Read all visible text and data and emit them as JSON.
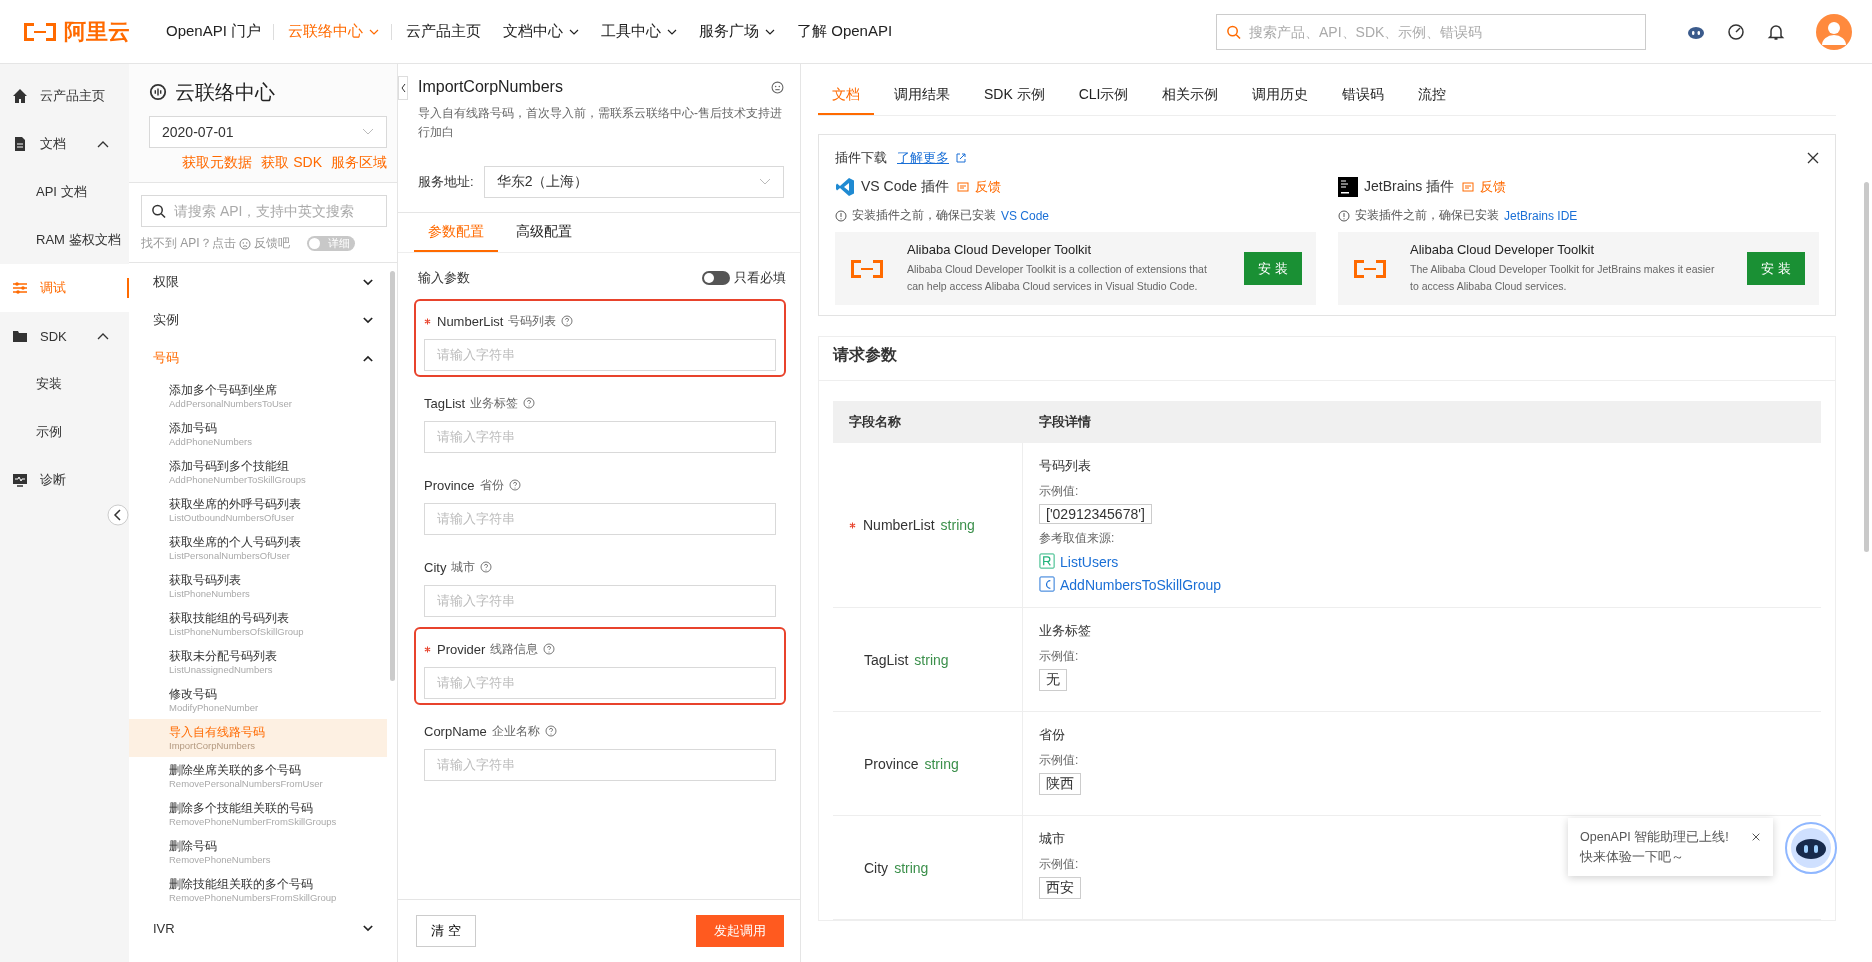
{
  "header": {
    "logo_text": "阿里云",
    "nav": [
      {
        "label": "OpenAPI 门户",
        "selected": false,
        "caret": false
      },
      {
        "label": "云联络中心",
        "selected": true,
        "caret": true
      },
      {
        "label": "云产品主页",
        "selected": false,
        "caret": false
      },
      {
        "label": "文档中心",
        "selected": false,
        "caret": true
      },
      {
        "label": "工具中心",
        "selected": false,
        "caret": true
      },
      {
        "label": "服务广场",
        "selected": false,
        "caret": true
      },
      {
        "label": "了解 OpenAPI",
        "selected": false,
        "caret": false
      }
    ],
    "search": {
      "placeholder": "搜索产品、API、SDK、示例、错误码"
    }
  },
  "sidebar": {
    "items": [
      {
        "kind": "home",
        "label": "云产品主页",
        "selected": false
      },
      {
        "kind": "doc",
        "label": "文档",
        "selected": false,
        "expanded": true,
        "children": [
          {
            "label": "API 文档",
            "selected": false
          },
          {
            "label": "RAM 鉴权文档",
            "selected": false
          }
        ]
      },
      {
        "kind": "debug",
        "label": "调试",
        "selected": true
      },
      {
        "kind": "sdk",
        "label": "SDK",
        "selected": false,
        "expanded": true,
        "children": [
          {
            "label": "安装",
            "selected": false
          },
          {
            "label": "示例",
            "selected": false
          }
        ]
      },
      {
        "kind": "diag",
        "label": "诊断",
        "selected": false
      }
    ]
  },
  "api_panel": {
    "title": "云联络中心",
    "version": "2020-07-01",
    "links": [
      "获取元数据",
      "获取 SDK",
      "服务区域"
    ],
    "search": {
      "placeholder": "请搜索 API，支持中英文搜索"
    },
    "feedback_prefix": "找不到 API？点击",
    "feedback_link": "反馈吧",
    "detail_toggle": {
      "label": "详细",
      "on": false
    },
    "groups": [
      {
        "label": "权限",
        "expanded": false,
        "selected": false
      },
      {
        "label": "实例",
        "expanded": false,
        "selected": false
      },
      {
        "label": "号码",
        "expanded": true,
        "selected": true,
        "items": [
          {
            "name": "添加多个号码到坐席",
            "code": "AddPersonalNumbersToUser",
            "selected": false
          },
          {
            "name": "添加号码",
            "code": "AddPhoneNumbers",
            "selected": false
          },
          {
            "name": "添加号码到多个技能组",
            "code": "AddPhoneNumberToSkillGroups",
            "selected": false
          },
          {
            "name": "获取坐席的外呼号码列表",
            "code": "ListOutboundNumbersOfUser",
            "selected": false
          },
          {
            "name": "获取坐席的个人号码列表",
            "code": "ListPersonalNumbersOfUser",
            "selected": false
          },
          {
            "name": "获取号码列表",
            "code": "ListPhoneNumbers",
            "selected": false
          },
          {
            "name": "获取技能组的号码列表",
            "code": "ListPhoneNumbersOfSkillGroup",
            "selected": false
          },
          {
            "name": "获取未分配号码列表",
            "code": "ListUnassignedNumbers",
            "selected": false
          },
          {
            "name": "修改号码",
            "code": "ModifyPhoneNumber",
            "selected": false
          },
          {
            "name": "导入自有线路号码",
            "code": "ImportCorpNumbers",
            "selected": true
          },
          {
            "name": "删除坐席关联的多个号码",
            "code": "RemovePersonalNumbersFromUser",
            "selected": false
          },
          {
            "name": "删除多个技能组关联的号码",
            "code": "RemovePhoneNumberFromSkillGroups",
            "selected": false
          },
          {
            "name": "删除号码",
            "code": "RemovePhoneNumbers",
            "selected": false
          },
          {
            "name": "删除技能组关联的多个号码",
            "code": "RemovePhoneNumbersFromSkillGroup",
            "selected": false
          }
        ]
      },
      {
        "label": "IVR",
        "expanded": false,
        "selected": false
      }
    ]
  },
  "form": {
    "title": "ImportCorpNumbers",
    "description": "导入自有线路号码，首次导入前，需联系云联络中心-售后技术支持进行加白",
    "service_label": "服务地址:",
    "service_value": "华东2（上海）",
    "tabs": [
      {
        "label": "参数配置",
        "selected": true
      },
      {
        "label": "高级配置",
        "selected": false
      }
    ],
    "section_label": "输入参数",
    "required_toggle": {
      "label": "只看必填",
      "on": false
    },
    "fields": [
      {
        "name": "NumberList",
        "label_cn": "号码列表",
        "required": true,
        "highlighted": true,
        "placeholder": "请输入字符串"
      },
      {
        "name": "TagList",
        "label_cn": "业务标签",
        "required": false,
        "highlighted": false,
        "placeholder": "请输入字符串"
      },
      {
        "name": "Province",
        "label_cn": "省份",
        "required": false,
        "highlighted": false,
        "placeholder": "请输入字符串"
      },
      {
        "name": "City",
        "label_cn": "城市",
        "required": false,
        "highlighted": false,
        "placeholder": "请输入字符串"
      },
      {
        "name": "Provider",
        "label_cn": "线路信息",
        "required": true,
        "highlighted": true,
        "placeholder": "请输入字符串"
      },
      {
        "name": "CorpName",
        "label_cn": "企业名称",
        "required": false,
        "highlighted": false,
        "placeholder": "请输入字符串"
      }
    ],
    "buttons": {
      "clear": "清 空",
      "submit": "发起调用"
    }
  },
  "docs": {
    "tabs": [
      {
        "label": "文档",
        "selected": true
      },
      {
        "label": "调用结果",
        "selected": false
      },
      {
        "label": "SDK 示例",
        "selected": false
      },
      {
        "label": "CLI示例",
        "selected": false
      },
      {
        "label": "相关示例",
        "selected": false
      },
      {
        "label": "调用历史",
        "selected": false
      },
      {
        "label": "错误码",
        "selected": false
      },
      {
        "label": "流控",
        "selected": false
      }
    ],
    "plugin_box": {
      "title": "插件下载",
      "link": "了解更多",
      "plugins": [
        {
          "kind": "vscode",
          "name": "VS Code 插件",
          "feedback": "反馈",
          "note": "安装插件之前，确保已安装",
          "note_link": "VS Code",
          "toolkit_title": "Alibaba Cloud Developer Toolkit",
          "toolkit_desc": "Alibaba Cloud Developer Toolkit is a collection of extensions that can help access Alibaba Cloud services in Visual Studio Code.",
          "install": "安 装"
        },
        {
          "kind": "jetbrains",
          "name": "JetBrains 插件",
          "feedback": "反馈",
          "note": "安装插件之前，确保已安装",
          "note_link": "JetBrains IDE",
          "toolkit_title": "Alibaba Cloud Developer Toolkit",
          "toolkit_desc": "The Alibaba Cloud Developer Toolkit for JetBrains makes it easier to access Alibaba Cloud services.",
          "install": "安 装"
        }
      ]
    },
    "request_title": "请求参数",
    "columns": [
      "字段名称",
      "字段详情"
    ],
    "rows": [
      {
        "name": "NumberList",
        "type": "string",
        "required": true,
        "desc": "号码列表",
        "example_label": "示例值:",
        "example": "['02912345678']",
        "source_label": "参考取值来源:",
        "sources": [
          {
            "kind": "read",
            "label": "ListUsers"
          },
          {
            "kind": "create",
            "label": "AddNumbersToSkillGroup"
          }
        ]
      },
      {
        "name": "TagList",
        "type": "string",
        "required": false,
        "desc": "业务标签",
        "example_label": "示例值:",
        "example": "无"
      },
      {
        "name": "Province",
        "type": "string",
        "required": false,
        "desc": "省份",
        "example_label": "示例值:",
        "example": "陕西"
      },
      {
        "name": "City",
        "type": "string",
        "required": false,
        "desc": "城市",
        "example_label": "示例值:",
        "example": "西安"
      }
    ]
  },
  "assistant": {
    "line1": "OpenAPI 智能助理已上线!",
    "line2": "快来体验一下吧～"
  }
}
